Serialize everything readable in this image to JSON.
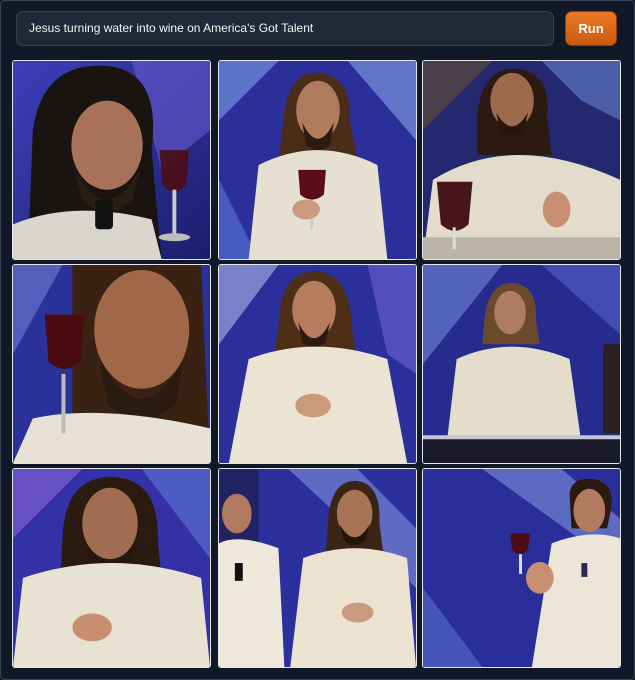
{
  "prompt": {
    "value": "Jesus turning water into wine on America's Got Talent"
  },
  "run_button": {
    "label": "Run"
  },
  "colors": {
    "accent": "#ea7a24",
    "background": "#0b0f19",
    "stage_blue": "#2b2f9c",
    "robe": "#e8e0cc"
  },
  "gallery": {
    "image_count": 9
  }
}
